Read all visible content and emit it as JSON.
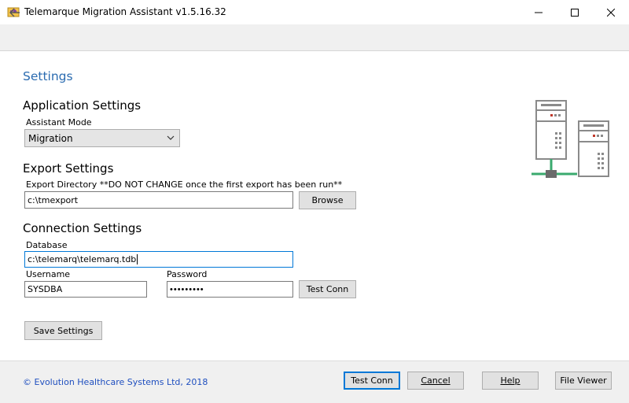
{
  "window": {
    "title": "Telemarque Migration Assistant v1.5.16.32",
    "controls": [
      "minimize-icon",
      "maximize-icon",
      "close-icon"
    ]
  },
  "nav": {
    "back_icon": "back-arrow-icon"
  },
  "page": {
    "title": "Settings",
    "application_settings": {
      "heading": "Application Settings",
      "assistant_mode_label": "Assistant Mode",
      "assistant_mode_value": "Migration"
    },
    "export_settings": {
      "heading": "Export Settings",
      "export_directory_label": "Export Directory  **DO NOT CHANGE once the first export has been run**",
      "export_directory_value": "c:\\tmexport",
      "browse_label": "Browse"
    },
    "connection_settings": {
      "heading": "Connection Settings",
      "database_label": "Database",
      "database_value": "c:\\telemarq\\telemarq.tdb",
      "username_label": "Username",
      "username_value": "SYSDBA",
      "password_label": "Password",
      "password_value": "masterkey",
      "test_conn_label": "Test Conn"
    },
    "save_settings_label": "Save Settings"
  },
  "footer": {
    "copyright": "© Evolution Healthcare Systems Ltd, 2018",
    "test_conn_label": "Test Conn",
    "cancel_label": "Cancel",
    "help_label": "Help",
    "file_viewer_label": "File Viewer"
  },
  "colors": {
    "accent_blue": "#2a6bb0",
    "link_blue": "#1f4fbf",
    "focus_blue": "#0078d7",
    "server_green": "#3aaa6e",
    "server_gray": "#8a8a8a"
  }
}
